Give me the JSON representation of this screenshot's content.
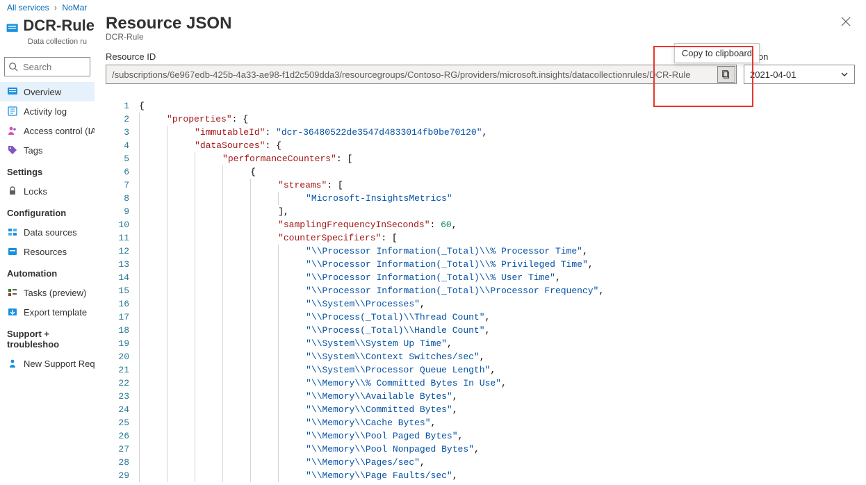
{
  "breadcrumb": {
    "item1": "All services",
    "item2": "NoMar"
  },
  "left": {
    "title": "DCR-Rule",
    "subtitle": "Data collection ru",
    "search_placeholder": "Search",
    "nav": {
      "overview": "Overview",
      "activity": "Activity log",
      "iam": "Access control (IAM",
      "tags": "Tags",
      "section_settings": "Settings",
      "locks": "Locks",
      "section_config": "Configuration",
      "datasources": "Data sources",
      "resources": "Resources",
      "section_automation": "Automation",
      "tasks": "Tasks (preview)",
      "export": "Export template",
      "section_support": "Support + troubleshoo",
      "newsupport": "New Support Requ"
    }
  },
  "blade": {
    "title": "Resource JSON",
    "subtitle": "DCR-Rule",
    "resource_id_label": "Resource ID",
    "resource_id_value": "/subscriptions/6e967edb-425b-4a33-ae98-f1d2c509dda3/resourcegroups/Contoso-RG/providers/microsoft.insights/datacollectionrules/DCR-Rule",
    "copy_tooltip": "Copy to clipboard",
    "api_label_fragment": "ersion",
    "api_version": "2021-04-01"
  },
  "code_lines": [
    [
      [
        "punc",
        "{"
      ]
    ],
    [
      [
        "ind",
        1
      ],
      [
        "key",
        "\"properties\""
      ],
      [
        "colon",
        ": "
      ],
      [
        "punc",
        "{"
      ]
    ],
    [
      [
        "ind",
        2
      ],
      [
        "key",
        "\"immutableId\""
      ],
      [
        "colon",
        ": "
      ],
      [
        "str",
        "\"dcr-36480522de3547d4833014fb0be70120\""
      ],
      [
        "punc",
        ","
      ]
    ],
    [
      [
        "ind",
        2
      ],
      [
        "key",
        "\"dataSources\""
      ],
      [
        "colon",
        ": "
      ],
      [
        "punc",
        "{"
      ]
    ],
    [
      [
        "ind",
        3
      ],
      [
        "key",
        "\"performanceCounters\""
      ],
      [
        "colon",
        ": "
      ],
      [
        "punc",
        "["
      ]
    ],
    [
      [
        "ind",
        4
      ],
      [
        "punc",
        "{"
      ]
    ],
    [
      [
        "ind",
        5
      ],
      [
        "key",
        "\"streams\""
      ],
      [
        "colon",
        ": "
      ],
      [
        "punc",
        "["
      ]
    ],
    [
      [
        "ind",
        6
      ],
      [
        "str",
        "\"Microsoft-InsightsMetrics\""
      ]
    ],
    [
      [
        "ind",
        5
      ],
      [
        "punc",
        "],"
      ]
    ],
    [
      [
        "ind",
        5
      ],
      [
        "key",
        "\"samplingFrequencyInSeconds\""
      ],
      [
        "colon",
        ": "
      ],
      [
        "num",
        "60"
      ],
      [
        "punc",
        ","
      ]
    ],
    [
      [
        "ind",
        5
      ],
      [
        "key",
        "\"counterSpecifiers\""
      ],
      [
        "colon",
        ": "
      ],
      [
        "punc",
        "["
      ]
    ],
    [
      [
        "ind",
        6
      ],
      [
        "str",
        "\"\\\\Processor Information(_Total)\\\\% Processor Time\""
      ],
      [
        "punc",
        ","
      ]
    ],
    [
      [
        "ind",
        6
      ],
      [
        "str",
        "\"\\\\Processor Information(_Total)\\\\% Privileged Time\""
      ],
      [
        "punc",
        ","
      ]
    ],
    [
      [
        "ind",
        6
      ],
      [
        "str",
        "\"\\\\Processor Information(_Total)\\\\% User Time\""
      ],
      [
        "punc",
        ","
      ]
    ],
    [
      [
        "ind",
        6
      ],
      [
        "str",
        "\"\\\\Processor Information(_Total)\\\\Processor Frequency\""
      ],
      [
        "punc",
        ","
      ]
    ],
    [
      [
        "ind",
        6
      ],
      [
        "str",
        "\"\\\\System\\\\Processes\""
      ],
      [
        "punc",
        ","
      ]
    ],
    [
      [
        "ind",
        6
      ],
      [
        "str",
        "\"\\\\Process(_Total)\\\\Thread Count\""
      ],
      [
        "punc",
        ","
      ]
    ],
    [
      [
        "ind",
        6
      ],
      [
        "str",
        "\"\\\\Process(_Total)\\\\Handle Count\""
      ],
      [
        "punc",
        ","
      ]
    ],
    [
      [
        "ind",
        6
      ],
      [
        "str",
        "\"\\\\System\\\\System Up Time\""
      ],
      [
        "punc",
        ","
      ]
    ],
    [
      [
        "ind",
        6
      ],
      [
        "str",
        "\"\\\\System\\\\Context Switches/sec\""
      ],
      [
        "punc",
        ","
      ]
    ],
    [
      [
        "ind",
        6
      ],
      [
        "str",
        "\"\\\\System\\\\Processor Queue Length\""
      ],
      [
        "punc",
        ","
      ]
    ],
    [
      [
        "ind",
        6
      ],
      [
        "str",
        "\"\\\\Memory\\\\% Committed Bytes In Use\""
      ],
      [
        "punc",
        ","
      ]
    ],
    [
      [
        "ind",
        6
      ],
      [
        "str",
        "\"\\\\Memory\\\\Available Bytes\""
      ],
      [
        "punc",
        ","
      ]
    ],
    [
      [
        "ind",
        6
      ],
      [
        "str",
        "\"\\\\Memory\\\\Committed Bytes\""
      ],
      [
        "punc",
        ","
      ]
    ],
    [
      [
        "ind",
        6
      ],
      [
        "str",
        "\"\\\\Memory\\\\Cache Bytes\""
      ],
      [
        "punc",
        ","
      ]
    ],
    [
      [
        "ind",
        6
      ],
      [
        "str",
        "\"\\\\Memory\\\\Pool Paged Bytes\""
      ],
      [
        "punc",
        ","
      ]
    ],
    [
      [
        "ind",
        6
      ],
      [
        "str",
        "\"\\\\Memory\\\\Pool Nonpaged Bytes\""
      ],
      [
        "punc",
        ","
      ]
    ],
    [
      [
        "ind",
        6
      ],
      [
        "str",
        "\"\\\\Memory\\\\Pages/sec\""
      ],
      [
        "punc",
        ","
      ]
    ],
    [
      [
        "ind",
        6
      ],
      [
        "str",
        "\"\\\\Memory\\\\Page Faults/sec\""
      ],
      [
        "punc",
        ","
      ]
    ]
  ]
}
